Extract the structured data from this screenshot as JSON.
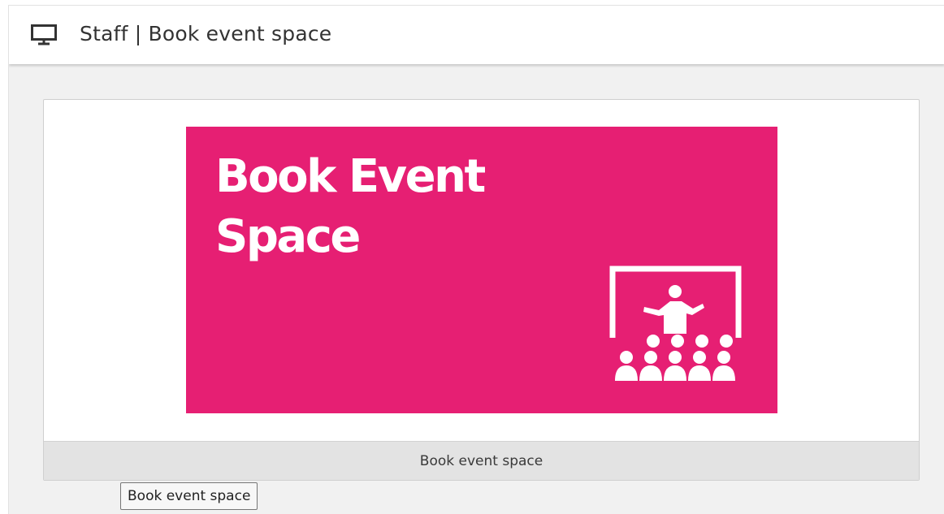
{
  "header": {
    "icon": "monitor-icon",
    "title": "Staff | Book event space"
  },
  "tile": {
    "banner": {
      "line1": "Book Event",
      "line2": "Space",
      "background_color": "#e61f73",
      "text_color": "#ffffff",
      "icon": "presentation-audience-icon"
    },
    "footer_label": "Book event space"
  },
  "tooltip": {
    "text": "Book event space"
  }
}
